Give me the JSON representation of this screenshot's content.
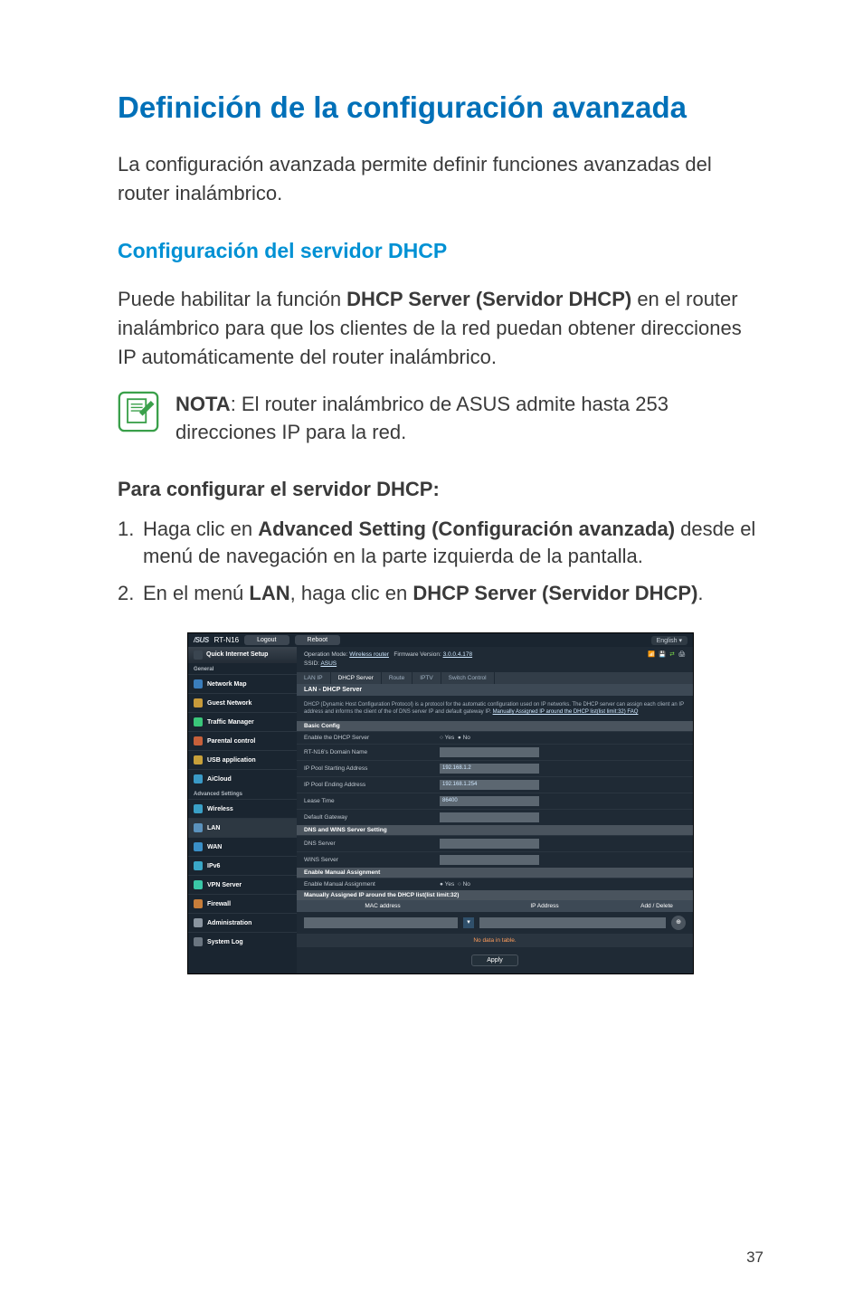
{
  "title": "Definición de la configuración avanzada",
  "intro": "La configuración avanzada permite definir funciones avanzadas del router inalámbrico.",
  "subhead": "Configuración del servidor DHCP",
  "body_pre": "Puede habilitar la función ",
  "body_bold": "DHCP Server (Servidor DHCP)",
  "body_post": " en el router inalámbrico para que los clientes de la red puedan obtener direcciones IP automáticamente del router inalámbrico.",
  "note_label": "NOTA",
  "note_text": ":    El router inalámbrico de ASUS admite hasta 253 direcciones IP para la red.",
  "steps_h": "Para configurar el servidor DHCP:",
  "step1_pre": "Haga clic en ",
  "step1_bold": "Advanced Setting (Configuración avanzada)",
  "step1_post": " desde el menú de navegación en la parte izquierda de la pantalla.",
  "step2_pre": "En el menú ",
  "step2_bold1": "LAN",
  "step2_mid": ", haga clic en ",
  "step2_bold2": "DHCP Server (Servidor DHCP)",
  "step2_post": ".",
  "page_num": "37",
  "router": {
    "logo": "/SUS",
    "model": "RT-N16",
    "logout": "Logout",
    "reboot": "Reboot",
    "lang": "English",
    "op_mode_label": "Operation Mode: ",
    "op_mode": "Wireless router",
    "fw_label": "Firmware Version: ",
    "fw": "3.0.0.4.178",
    "ssid_label": "SSID: ",
    "ssid": "ASUS",
    "qis": "Quick Internet Setup",
    "general": "General",
    "menu_netmap": "Network Map",
    "menu_guest": "Guest Network",
    "menu_traffic": "Traffic Manager",
    "menu_parental": "Parental control",
    "menu_usb": "USB application",
    "menu_aicloud": "AiCloud",
    "adv": "Advanced Settings",
    "menu_wireless": "Wireless",
    "menu_lan": "LAN",
    "menu_wan": "WAN",
    "menu_ipv6": "IPv6",
    "menu_vpn": "VPN Server",
    "menu_firewall": "Firewall",
    "menu_admin": "Administration",
    "menu_syslog": "System Log",
    "tab_lanip": "LAN IP",
    "tab_dhcp": "DHCP Server",
    "tab_route": "Route",
    "tab_iptv": "IPTV",
    "tab_switch": "Switch Control",
    "panel_h": "LAN - DHCP Server",
    "desc": "DHCP (Dynamic Host Configuration Protocol) is a protocol for the automatic configuration used on IP networks. The DHCP server can assign each client an IP address and informs the client of the of DNS server IP and default gateway IP. ",
    "desc_link": "Manually Assigned IP around the DHCP list(list limit:32) FAQ",
    "band_basic": "Basic Config",
    "r_enable": "Enable the DHCP Server",
    "r_yes": "Yes",
    "r_no": "No",
    "r_domain": "RT-N16's Domain Name",
    "r_start": "IP Pool Starting Address",
    "v_start": "192.168.1.2",
    "r_end": "IP Pool Ending Address",
    "v_end": "192.168.1.254",
    "r_lease": "Lease Time",
    "v_lease": "86400",
    "r_gateway": "Default Gateway",
    "band_dns": "DNS and WINS Server Setting",
    "r_dns": "DNS Server",
    "r_wins": "WINS Server",
    "band_manual": "Enable Manual Assignment",
    "r_manual": "Enable Manual Assignment",
    "band_list": "Manually Assigned IP around the DHCP list(list limit:32)",
    "th_mac": "MAC address",
    "th_ip": "IP Address",
    "th_ad": "Add / Delete",
    "empty": "No data in table.",
    "apply": "Apply"
  }
}
